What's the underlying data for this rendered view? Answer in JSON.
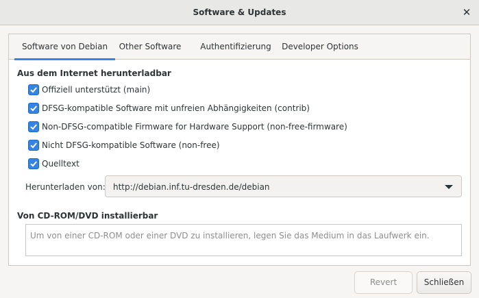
{
  "window": {
    "title": "Software & Updates"
  },
  "tabs": [
    {
      "label": "Software von Debian",
      "active": true
    },
    {
      "label": "Other Software",
      "active": false
    },
    {
      "label": "Authentifizierung",
      "active": false
    },
    {
      "label": "Developer Options",
      "active": false
    }
  ],
  "internet": {
    "heading": "Aus dem Internet herunterladbar",
    "components": [
      {
        "label": "Offiziell unterstützt (main)",
        "checked": true
      },
      {
        "label": "DFSG-kompatible Software mit unfreien Abhängigkeiten (contrib)",
        "checked": true
      },
      {
        "label": "Non-DFSG-compatible Firmware for Hardware Support (non-free-firmware)",
        "checked": true
      },
      {
        "label": "Nicht DFSG-kompatible Software (non-free)",
        "checked": true
      },
      {
        "label": "Quelltext",
        "checked": true
      }
    ],
    "download_from_label": "Herunterladen von:",
    "mirror": "http://debian.inf.tu-dresden.de/debian"
  },
  "cdrom": {
    "heading": "Von CD-ROM/DVD installierbar",
    "message": "Um von einer CD-ROM oder einer DVD zu installieren, legen Sie das Medium in das Laufwerk ein."
  },
  "buttons": {
    "revert": "Revert",
    "close": "Schließen"
  },
  "colors": {
    "accent": "#3584e4",
    "window_bg": "#f6f5f4",
    "text": "#2e3436",
    "disabled_text": "#8b8e8f"
  },
  "icons": {
    "close": "close-icon",
    "check": "checkmark-icon",
    "dropdown": "chevron-down-icon"
  }
}
